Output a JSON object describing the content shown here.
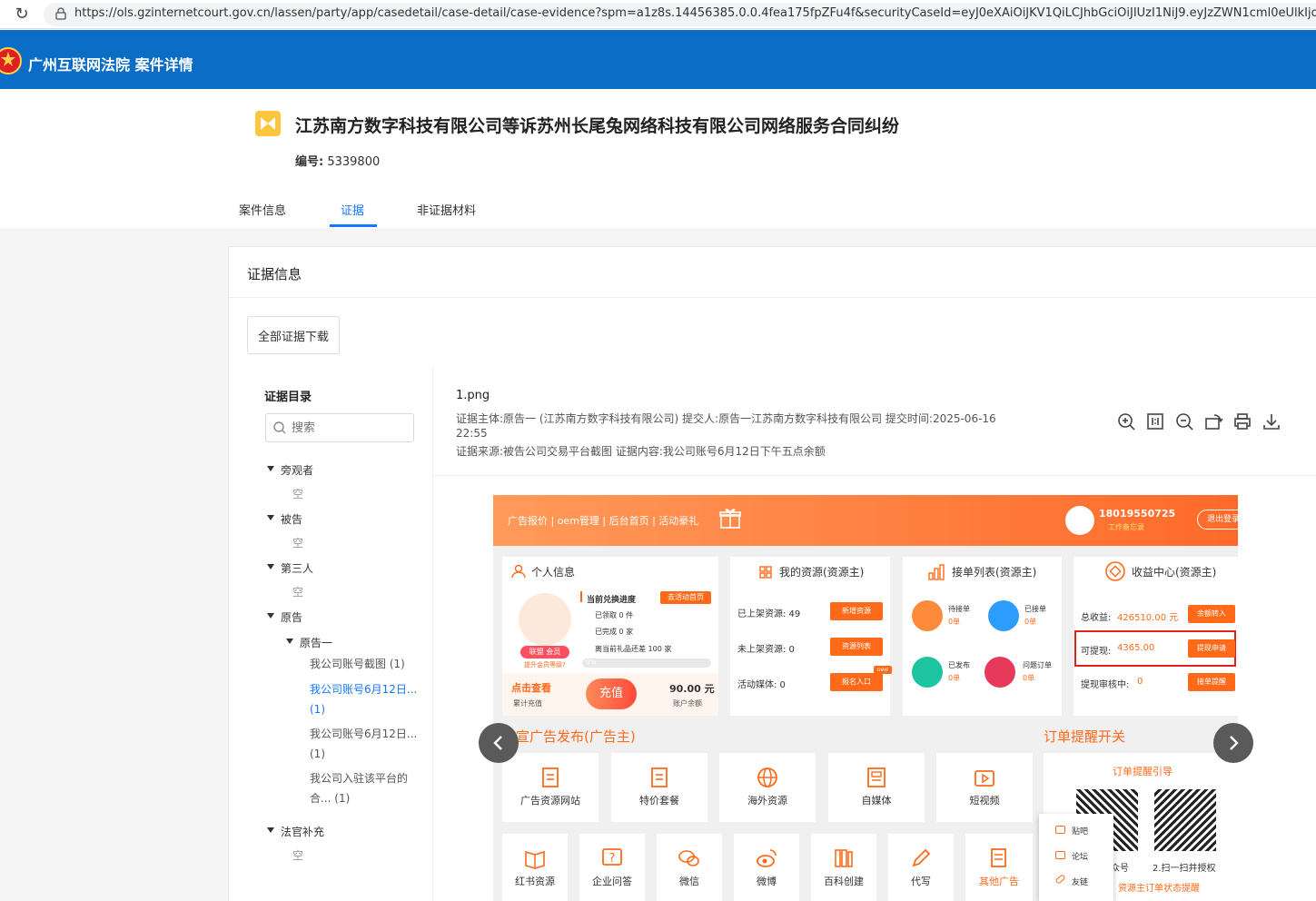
{
  "browser": {
    "url": "https://ols.gzinternetcourt.gov.cn/lassen/party/app/casedetail/case-detail/case-evidence?spm=a1z8s.14456385.0.0.4fea175fpZFu4f&securityCaseId=eyJ0eXAiOiJKV1QiLCJhbGciOiJIUzI1NiJ9.eyJzZWN1cml0eUlkIjoid0gweDEwT"
  },
  "header": {
    "title": "广州互联网法院 案件详情"
  },
  "case": {
    "title": "江苏南方数字科技有限公司等诉苏州长尾兔网络科技有限公司网络服务合同纠纷",
    "number_label": "编号:",
    "number": "5339800"
  },
  "tabs": [
    {
      "label": "案件信息"
    },
    {
      "label": "证据"
    },
    {
      "label": "非证据材料"
    }
  ],
  "evidence": {
    "section_title": "证据信息",
    "download_all": "全部证据下载",
    "dir_title": "证据目录",
    "search_placeholder": "搜索"
  },
  "tree": {
    "bystander": "旁观者",
    "defendant": "被告",
    "third": "第三人",
    "plaintiff": "原告",
    "plaintiff1": "原告一",
    "empty": "空",
    "judge": "法官补充",
    "leaves": [
      "我公司账号截图 (1)",
      "我公司账号6月12日...",
      "(1)",
      "我公司账号6月12日...",
      "(1)",
      "我公司入驻该平台的",
      "合... (1)"
    ]
  },
  "file": {
    "name": "1.png",
    "line1": "证据主体:原告一 (江苏南方数字科技有限公司) 提交人:原告一江苏南方数字科技有限公司 提交时间:2025-06-16",
    "line2": "22:55",
    "line3": "证据来源:被告公司交易平台截图 证据内容:我公司账号6月12日下午五点余额"
  },
  "shot": {
    "nav": "广告报价 | oem管理 | 后台首页 | 活动豪礼",
    "phone": "18019550725",
    "phone_sub": "工作备忘录",
    "logout": "退出登录",
    "p1": {
      "title": "个人信息",
      "progress": "当前兑换进度",
      "go": "去活动首页",
      "got": "已领取 0 件",
      "done": "已完成 0 家",
      "need": "离当前礼品还差 100 家",
      "pct": "0%",
      "member": "联盟 会员",
      "upgrade": "提升会员等级?",
      "check": "点击查看",
      "check_sub": "累计充值",
      "recharge": "充值",
      "balance": "90.00 元",
      "balance_sub": "账户余额"
    },
    "p2": {
      "title": "我的资源(资源主)",
      "on": "已上架资源: 49",
      "off": "未上架资源: 0",
      "media": "活动媒体: 0",
      "b1": "新增资源",
      "b2": "资源列表",
      "b3": "报名入口",
      "new": "new"
    },
    "p3": {
      "title": "接单列表(资源主)",
      "a": "待接单",
      "b": "已接单",
      "c": "已发布",
      "d": "问题订单",
      "z": "0单"
    },
    "p4": {
      "title": "收益中心(资源主)",
      "total": "总收益:",
      "total_v": "426510.00 元",
      "avail": "可提现:",
      "avail_v": "4365.00",
      "review": "提现审核中:",
      "review_v": "0",
      "b1": "余额转入",
      "b2": "提现申请",
      "b3": "接单提醒"
    },
    "sec1": "品宣广告发布(广告主)",
    "sec2": "订单提醒开关",
    "tiles1": [
      "广告资源网站",
      "特价套餐",
      "海外资源",
      "自媒体",
      "短视频"
    ],
    "tiles2": [
      "红书资源",
      "企业问答",
      "微信",
      "微博",
      "百科创建",
      "代写",
      "其他广告"
    ],
    "qr_title": "订单提醒引导",
    "qr1": "众号",
    "qr2": "2.扫一扫并授权",
    "qr3": "资源主订单状态提醒",
    "menu": [
      "贴吧",
      "论坛",
      "友链"
    ]
  }
}
